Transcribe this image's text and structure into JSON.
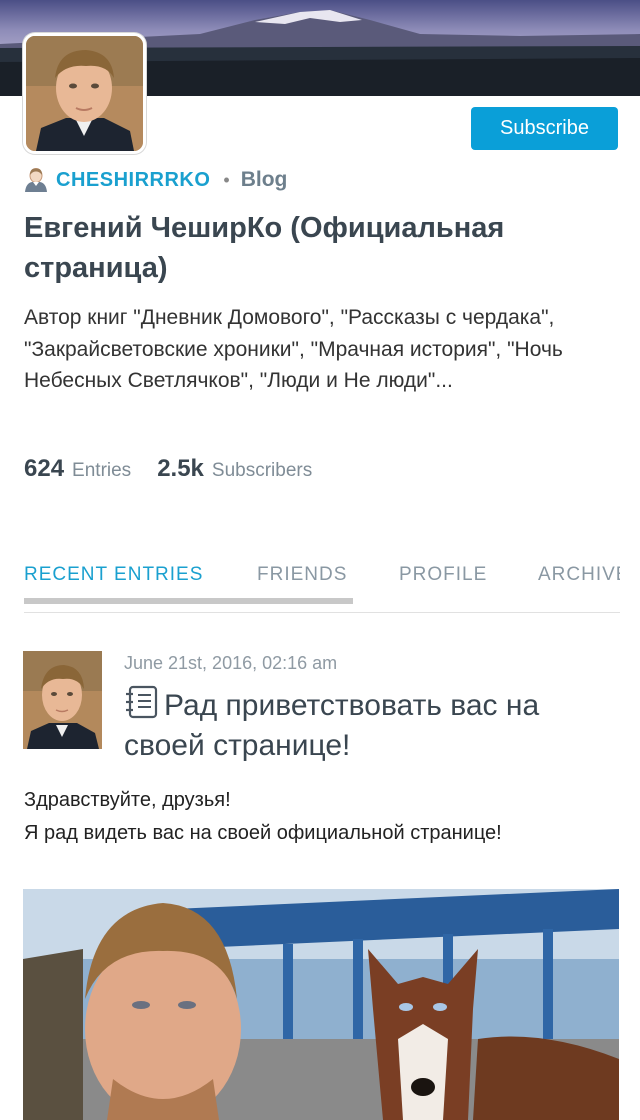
{
  "header": {
    "subscribe_label": "Subscribe"
  },
  "user": {
    "username": "CHESHIRRRKO",
    "separator": "•",
    "blog_type": "Blog",
    "title": "Евгений ЧеширКо (Официальная страница)",
    "description": "Автор книг \"Дневник Домового\", \"Рассказы с чердака\", \"Закрайсветовские хроники\", \"Мрачная история\", \"Ночь Небесных Светлячков\", \"Люди и Не люди\"..."
  },
  "stats": {
    "entries_count": "624",
    "entries_label": "Entries",
    "subscribers_count": "2.5k",
    "subscribers_label": "Subscribers"
  },
  "tabs": [
    {
      "label": "RECENT ENTRIES",
      "active": true
    },
    {
      "label": "FRIENDS",
      "active": false
    },
    {
      "label": "PROFILE",
      "active": false
    },
    {
      "label": "ARCHIVE",
      "active": false
    }
  ],
  "entry": {
    "date": "June 21st, 2016, 02:16 am",
    "title": "Рад приветствовать вас на своей странице!",
    "body_line1": "Здравствуйте, друзья!",
    "body_line2": "Я рад видеть вас на своей официальной странице!"
  },
  "icons": {
    "user": "user-icon",
    "entry": "document-icon"
  },
  "colors": {
    "accent": "#1aa0cf",
    "button": "#0a9fd8",
    "title_text": "#3a4650",
    "muted": "#8a98a3"
  }
}
